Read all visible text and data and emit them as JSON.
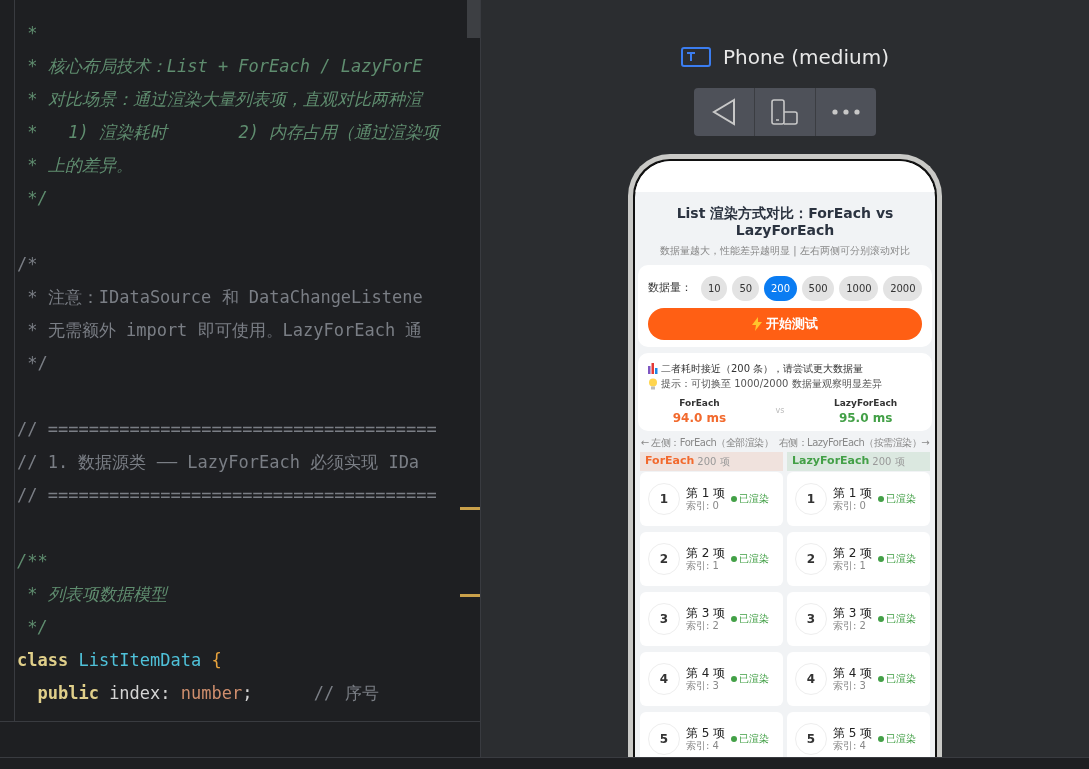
{
  "editor": {
    "lines": [
      {
        "tokens": [
          {
            "kind": "doc",
            "text": " *"
          }
        ]
      },
      {
        "tokens": [
          {
            "kind": "doc",
            "text": " * 核心布局技术：List + ForEach / LazyForE"
          }
        ]
      },
      {
        "tokens": [
          {
            "kind": "doc",
            "text": " * 对比场景：通过渲染大量列表项，直观对比两种渲"
          }
        ]
      },
      {
        "tokens": [
          {
            "kind": "doc",
            "text": " *   1) 渲染耗时       2) 内存占用（通过渲染项"
          }
        ]
      },
      {
        "tokens": [
          {
            "kind": "doc",
            "text": " * 上的差异。"
          }
        ]
      },
      {
        "tokens": [
          {
            "kind": "doc",
            "text": " */"
          }
        ]
      },
      {
        "kind": "blank"
      },
      {
        "tokens": [
          {
            "kind": "comment",
            "text": "/*"
          }
        ]
      },
      {
        "tokens": [
          {
            "kind": "comment",
            "text": " * 注意：IDataSource 和 DataChangeListene"
          }
        ]
      },
      {
        "tokens": [
          {
            "kind": "comment",
            "text": " * 无需额外 import 即可使用。LazyForEach 通"
          }
        ]
      },
      {
        "tokens": [
          {
            "kind": "comment",
            "text": " */"
          }
        ]
      },
      {
        "kind": "blank"
      },
      {
        "tokens": [
          {
            "kind": "comment",
            "text": "// ======================================"
          }
        ]
      },
      {
        "tokens": [
          {
            "kind": "comment",
            "text": "// 1. 数据源类 —— LazyForEach 必须实现 IDa"
          }
        ]
      },
      {
        "tokens": [
          {
            "kind": "comment",
            "text": "// ======================================"
          }
        ]
      },
      {
        "kind": "blank"
      },
      {
        "tokens": [
          {
            "kind": "doc",
            "text": "/**"
          }
        ]
      },
      {
        "tokens": [
          {
            "kind": "doc",
            "text": " * 列表项数据模型"
          }
        ]
      },
      {
        "tokens": [
          {
            "kind": "doc",
            "text": " */"
          }
        ]
      },
      {
        "tokens": [
          {
            "kind": "keyword",
            "text": "class "
          },
          {
            "kind": "class-name",
            "text": "ListItemData "
          },
          {
            "kind": "brace",
            "text": "{"
          }
        ]
      },
      {
        "tokens": [
          {
            "kind": "keyword",
            "text": "  public "
          },
          {
            "kind": "plain",
            "text": "index: "
          },
          {
            "kind": "type",
            "text": "number"
          },
          {
            "kind": "plain",
            "text": ";      "
          },
          {
            "kind": "comment",
            "text": "// 序号"
          }
        ]
      }
    ]
  },
  "preview": {
    "device": "Phone (medium)"
  },
  "app": {
    "title": "List 渲染方式对比：ForEach vs LazyForEach",
    "subtitle": "数据量越大，性能差异越明显 | 左右两侧可分别滚动对比",
    "count_label": "数据量：",
    "counts": [
      {
        "label": "10",
        "selected": false
      },
      {
        "label": "50",
        "selected": false
      },
      {
        "label": "200",
        "selected": true
      },
      {
        "label": "500",
        "selected": false
      },
      {
        "label": "1000",
        "selected": false
      },
      {
        "label": "2000",
        "selected": false
      }
    ],
    "start_button": "开始测试",
    "result": {
      "message": "二者耗时接近（200 条），请尝试更大数据量",
      "tip": "提示：可切换至 1000/2000 数据量观察明显差异",
      "left": {
        "name": "ForEach",
        "time": "94.0 ms"
      },
      "vs": "vs",
      "right": {
        "name": "LazyForEach",
        "time": "95.0 ms"
      }
    },
    "hint": "← 左侧：ForEach（全部渲染）  右侧：LazyForEach（按需渲染）→",
    "columns": [
      {
        "name": "ForEach",
        "count": "200 项",
        "color": "#f26a2e",
        "items": [
          {
            "number": "1",
            "title": "第 1 项",
            "index": "索引: 0",
            "status": "已渲染"
          },
          {
            "number": "2",
            "title": "第 2 项",
            "index": "索引: 1",
            "status": "已渲染"
          },
          {
            "number": "3",
            "title": "第 3 项",
            "index": "索引: 2",
            "status": "已渲染"
          },
          {
            "number": "4",
            "title": "第 4 项",
            "index": "索引: 3",
            "status": "已渲染"
          },
          {
            "number": "5",
            "title": "第 5 项",
            "index": "索引: 4",
            "status": "已渲染"
          }
        ]
      },
      {
        "name": "LazyForEach",
        "count": "200 项",
        "color": "#43a047",
        "items": [
          {
            "number": "1",
            "title": "第 1 项",
            "index": "索引: 0",
            "status": "已渲染"
          },
          {
            "number": "2",
            "title": "第 2 项",
            "index": "索引: 1",
            "status": "已渲染"
          },
          {
            "number": "3",
            "title": "第 3 项",
            "index": "索引: 2",
            "status": "已渲染"
          },
          {
            "number": "4",
            "title": "第 4 项",
            "index": "索引: 3",
            "status": "已渲染"
          },
          {
            "number": "5",
            "title": "第 5 项",
            "index": "索引: 4",
            "status": "已渲染"
          }
        ]
      }
    ]
  }
}
